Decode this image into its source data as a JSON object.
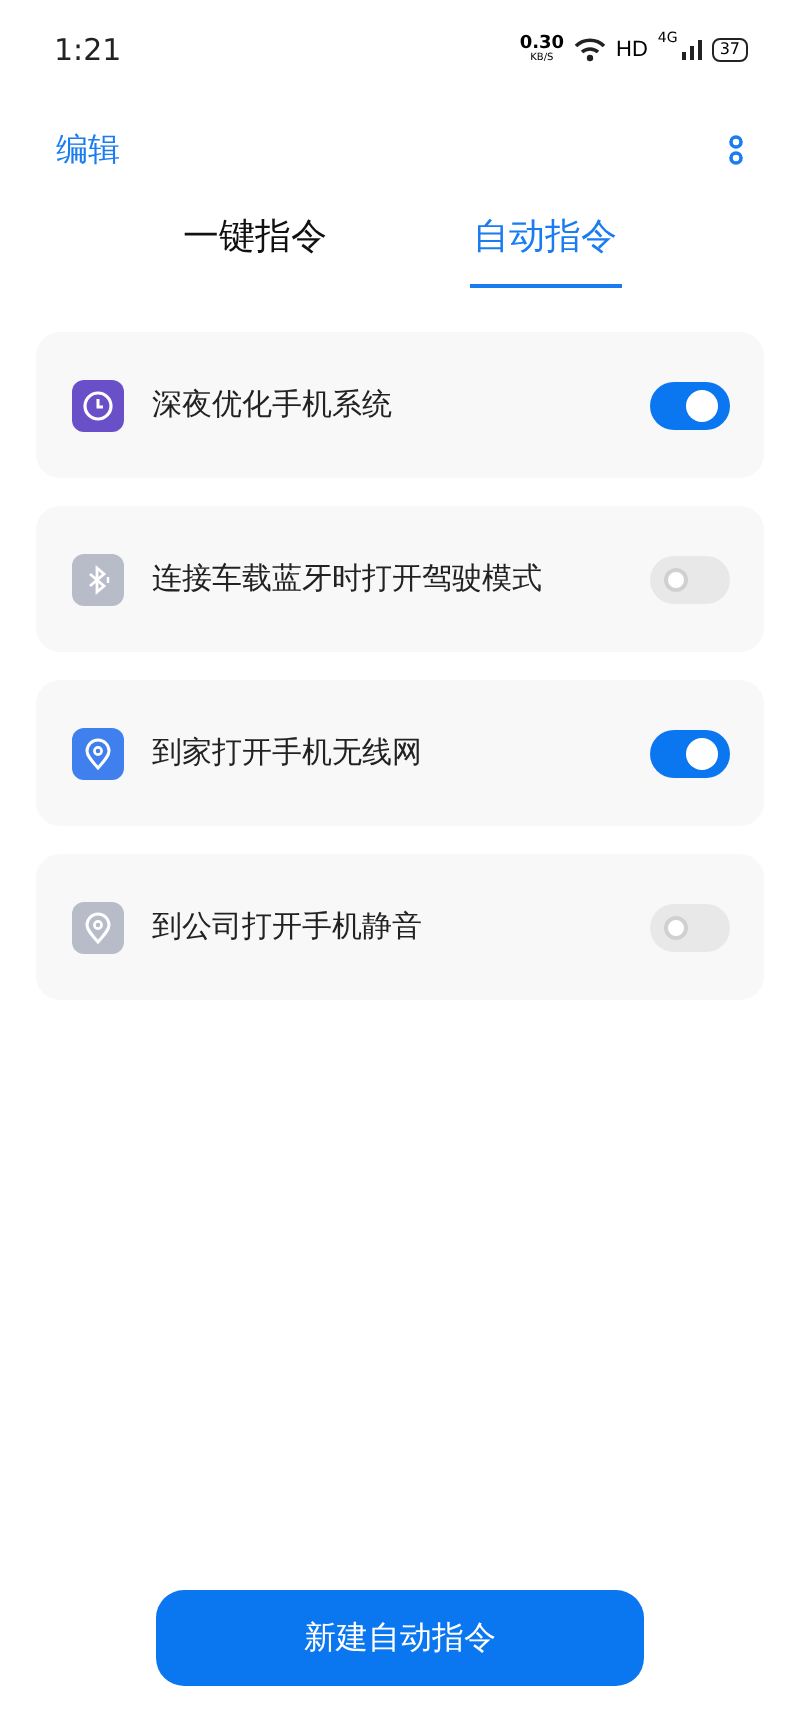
{
  "status_bar": {
    "time": "1:21",
    "speed": "0.30",
    "speed_unit": "KB/S",
    "hd": "HD",
    "network": "4G",
    "battery": "37"
  },
  "header": {
    "edit": "编辑"
  },
  "tabs": [
    {
      "label": "一键指令",
      "selected": false
    },
    {
      "label": "自动指令",
      "selected": true
    }
  ],
  "commands": [
    {
      "kind": "clock",
      "color": "#6a50c8",
      "title": "深夜优化手机系统",
      "on": true
    },
    {
      "kind": "bluetooth",
      "color": "#b8bcc8",
      "title": "连接车载蓝牙时打开驾驶模式",
      "on": false
    },
    {
      "kind": "location",
      "color": "#3f7fee",
      "title": "到家打开手机无线网",
      "on": true
    },
    {
      "kind": "location",
      "color": "#b8bcc8",
      "title": "到公司打开手机静音",
      "on": false
    }
  ],
  "new_button": "新建自动指令"
}
